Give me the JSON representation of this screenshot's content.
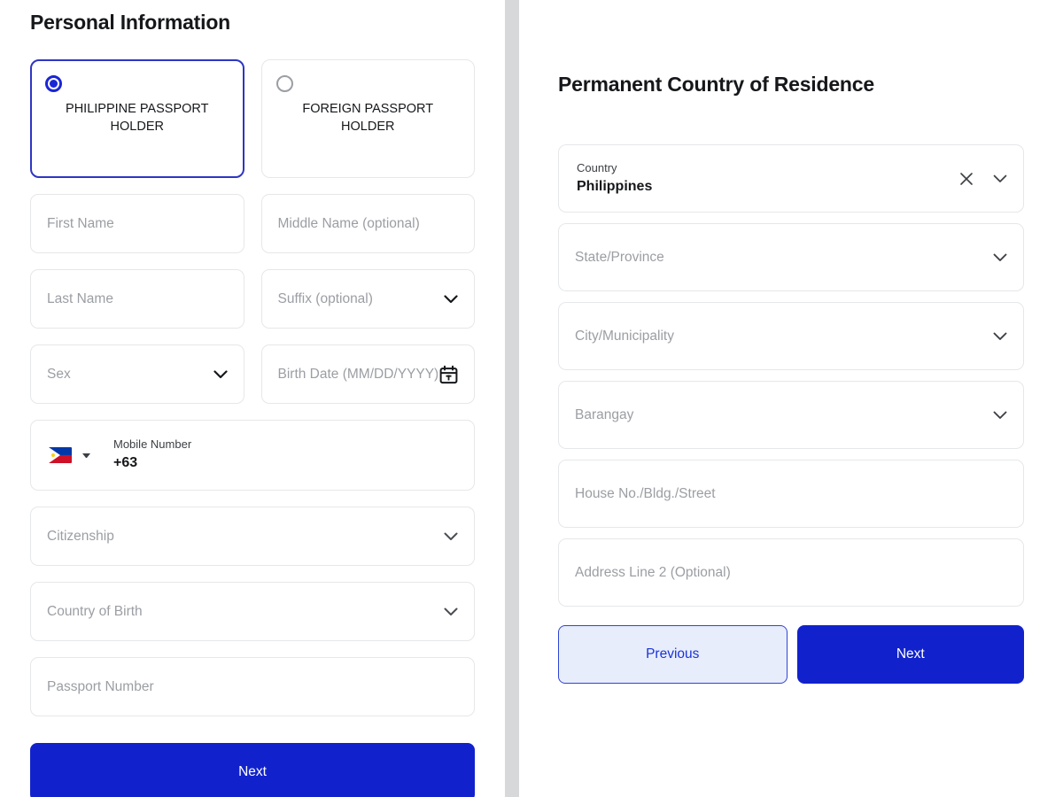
{
  "left_panel": {
    "heading": "Personal Information",
    "holder_options": [
      {
        "label": "PHILIPPINE PASSPORT HOLDER",
        "selected": true
      },
      {
        "label": "FOREIGN PASSPORT HOLDER",
        "selected": false
      }
    ],
    "fields": {
      "first_name": {
        "placeholder": "First Name"
      },
      "middle_name": {
        "placeholder": "Middle Name (optional)"
      },
      "last_name": {
        "placeholder": "Last Name"
      },
      "suffix": {
        "placeholder": "Suffix (optional)"
      },
      "sex": {
        "placeholder": "Sex"
      },
      "birth_date": {
        "placeholder": "Birth Date (MM/DD/YYYY)"
      },
      "mobile": {
        "label": "Mobile Number",
        "value": "+63",
        "country_code_flag": "philippines-flag"
      },
      "citizenship": {
        "placeholder": "Citizenship"
      },
      "country_of_birth": {
        "placeholder": "Country of Birth"
      },
      "passport_number": {
        "placeholder": "Passport Number"
      }
    },
    "next_label": "Next"
  },
  "right_panel": {
    "heading": "Permanent Country of Residence",
    "fields": {
      "country": {
        "label": "Country",
        "value": "Philippines"
      },
      "state": {
        "placeholder": "State/Province"
      },
      "city": {
        "placeholder": "City/Municipality"
      },
      "barangay": {
        "placeholder": "Barangay"
      },
      "house": {
        "placeholder": "House No./Bldg./Street"
      },
      "address2": {
        "placeholder": "Address Line 2 (Optional)"
      }
    },
    "previous_label": "Previous",
    "next_label": "Next"
  },
  "colors": {
    "primary_blue": "#1122cc",
    "selected_border": "#2d36c4",
    "secondary_bg": "#e8edfb",
    "placeholder_gray": "#9b9ea3",
    "divider_gray": "#d6d8da"
  }
}
